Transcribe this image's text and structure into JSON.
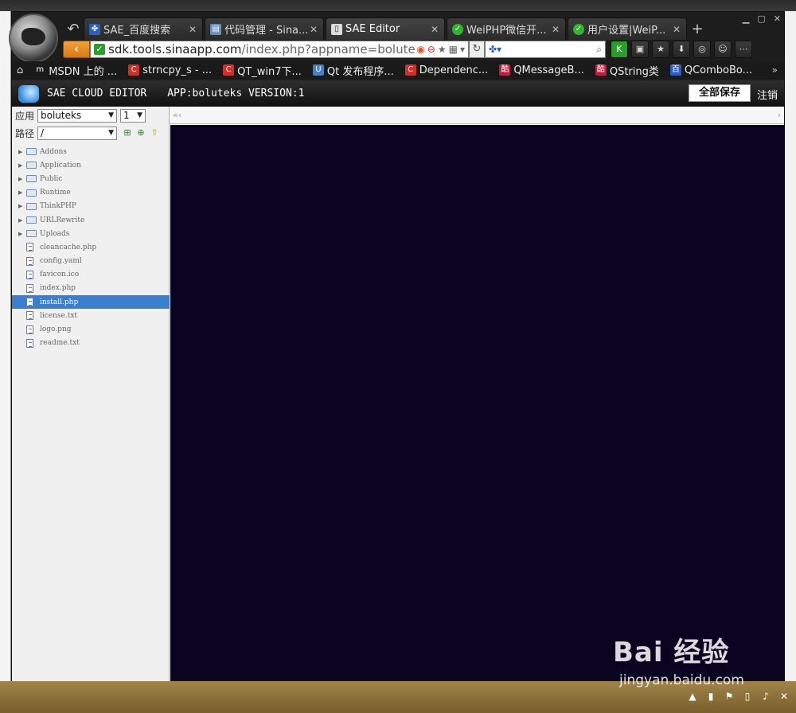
{
  "browser": {
    "tabs": [
      {
        "title": "SAE_百度搜索",
        "favicon": "baidu-icon",
        "color": "#2b5ec9"
      },
      {
        "title": "代码管理 - Sina...",
        "favicon": "page-icon",
        "color": "#6a8fbf"
      },
      {
        "title": "SAE Editor",
        "favicon": "page-icon",
        "color": "#dddddd",
        "active": true
      },
      {
        "title": "WeiPHP微信开...",
        "favicon": "weiphp-icon",
        "color": "#2fb52f"
      },
      {
        "title": "用户设置|WeiP...",
        "favicon": "weiphp-icon",
        "color": "#2fb52f"
      }
    ],
    "new_tab": "+",
    "url": {
      "host": "sdk.tools.sinaapp.com",
      "path": "/index.php?appname=boluteks&"
    },
    "bookmarks": [
      {
        "label": "MSDN 上的 ...",
        "icon": "m"
      },
      {
        "label": "strncpy_s - ...",
        "icon": "C"
      },
      {
        "label": "QT_win7下...",
        "icon": "C"
      },
      {
        "label": "Qt 发布程序...",
        "icon": "U"
      },
      {
        "label": "Dependenc...",
        "icon": "C"
      },
      {
        "label": "QMessageB...",
        "icon": "酷"
      },
      {
        "label": "QString类",
        "icon": "酷"
      },
      {
        "label": "QComboBo...",
        "icon": "百"
      }
    ]
  },
  "sae": {
    "title": "SAE CLOUD EDITOR",
    "app_info": "APP:boluteks VERSION:1",
    "save_all": "全部保存",
    "logout": "注销",
    "app_label": "应用",
    "app_value": "boluteks",
    "version_value": "1",
    "path_label": "路径",
    "path_value": "/",
    "tabs_left": "«‹",
    "tabs_right": "›"
  },
  "tree": {
    "folders": [
      "Addons",
      "Application",
      "Public",
      "Runtime",
      "ThinkPHP",
      "URLRewrite",
      "Uploads"
    ],
    "files": [
      "cleancache.php",
      "config.yaml",
      "favicon.ico",
      "index.php",
      "install.php",
      "license.txt",
      "logo.png",
      "readme.txt"
    ],
    "selected": "install.php"
  },
  "watermark": {
    "main": "Bai 经验",
    "sub": "jingyan.baidu.com"
  },
  "colors": {
    "editor_bg": "#0a0420",
    "selected_row": "#3a7fcf",
    "back_button": "#e58c20"
  }
}
